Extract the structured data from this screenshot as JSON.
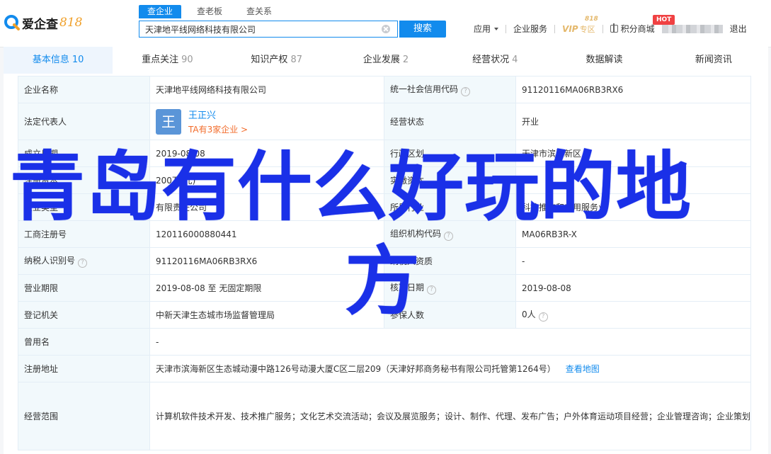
{
  "logo": {
    "text": "爱企查",
    "num": "818"
  },
  "search": {
    "tabs": [
      "查企业",
      "查老板",
      "查关系"
    ],
    "active_tab": 0,
    "query": "天津地平线网络科技有限公司",
    "button": "搜索"
  },
  "nav": {
    "app": "应用",
    "service": "企业服务",
    "vip": "VIP",
    "vip_sub": "专区",
    "vip_badge": "818",
    "points": "积分商城",
    "hot": "HOT",
    "logout": "退出"
  },
  "tabs": [
    {
      "label": "基本信息",
      "count": "10"
    },
    {
      "label": "重点关注",
      "count": "90"
    },
    {
      "label": "知识产权",
      "count": "87"
    },
    {
      "label": "企业发展",
      "count": "2"
    },
    {
      "label": "经营状况",
      "count": "4"
    },
    {
      "label": "数据解读",
      "count": ""
    },
    {
      "label": "新闻资讯",
      "count": ""
    }
  ],
  "info": {
    "company_name_label": "企业名称",
    "company_name": "天津地平线网络科技有限公司",
    "credit_code_label": "统一社会信用代码",
    "credit_code": "91120116MA06RB3RX6",
    "legal_rep_label": "法定代表人",
    "legal_rep_avatar": "王",
    "legal_rep_name": "王正兴",
    "legal_rep_sub": "TA有3家企业 >",
    "status_label": "经营状态",
    "status": "开业",
    "founded_label": "成立日期",
    "founded": "2019-08-08",
    "region_label": "行政区划",
    "region": "天津市滨海新区",
    "reg_capital_label": "注册资本",
    "reg_capital": "200万(元)",
    "paid_capital_label": "实缴资本",
    "paid_capital": "-",
    "company_type_label": "企业类型",
    "company_type": "有限责任公司",
    "industry_label": "所属行业",
    "industry": "科技推广和应用服务业",
    "reg_no_label": "工商注册号",
    "reg_no": "120116000880441",
    "org_code_label": "组织机构代码",
    "org_code": "MA06RB3R-X",
    "tax_id_label": "纳税人识别号",
    "tax_id": "91120116MA06RB3RX6",
    "taxpayer_qual_label": "纳税人资质",
    "taxpayer_qual": "-",
    "term_label": "营业期限",
    "term": "2019-08-08 至 无固定期限",
    "approval_date_label": "核准日期",
    "approval_date": "2019-08-08",
    "authority_label": "登记机关",
    "authority": "中新天津生态城市场监督管理局",
    "insured_label": "参保人数",
    "insured": "0人",
    "former_name_label": "曾用名",
    "former_name": "-",
    "address_label": "注册地址",
    "address": "天津市滨海新区生态城动漫中路126号动漫大厦C区二层209（天津好邦商务秘书有限公司托管第1264号）",
    "map_link": "查看地图",
    "scope_label": "经营范围",
    "scope": "计算机软件技术开发、技术推广服务；文化艺术交流活动；会议及展览服务；设计、制作、代理、发布广告；户外体育运动项目经营；企业管理咨询；企业策划；贸易信息咨询；文化艺术交流策划；影视策划；市场信息咨询与调查；企业形象设计；舞台灯光设计；包装设计；产品设计；电脑图文设计、制作；经营性演出及经纪业务；供应链管理；基础软件服务；应用软件服务；出版物零售；从事互联网文化活动；互联网信息服务。（依法须经批准的项目，经相关部门批准后方可开展经营活动）"
  },
  "overlay": {
    "line1": "青岛有什么好玩的地",
    "line2": "方"
  },
  "colors": {
    "accent": "#128bed",
    "overlay": "#1a30e8",
    "orange": "#f26c2b",
    "hot": "#f04142"
  }
}
